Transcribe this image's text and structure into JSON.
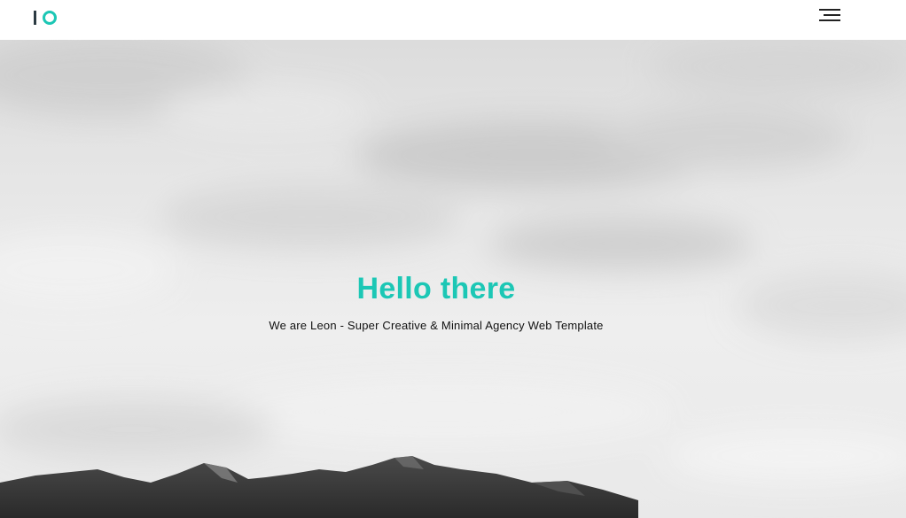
{
  "navbar": {
    "logo_text": "IO",
    "menu_icon": "hamburger-menu-icon"
  },
  "hero": {
    "title": "Hello there",
    "subtitle": "We are Leon - Super Creative & Minimal Agency Web Template"
  },
  "colors": {
    "accent": "#1cc7b5",
    "logo_dark": "#2b3a42",
    "text_dark": "#111111",
    "nav_bg": "#ffffff"
  }
}
